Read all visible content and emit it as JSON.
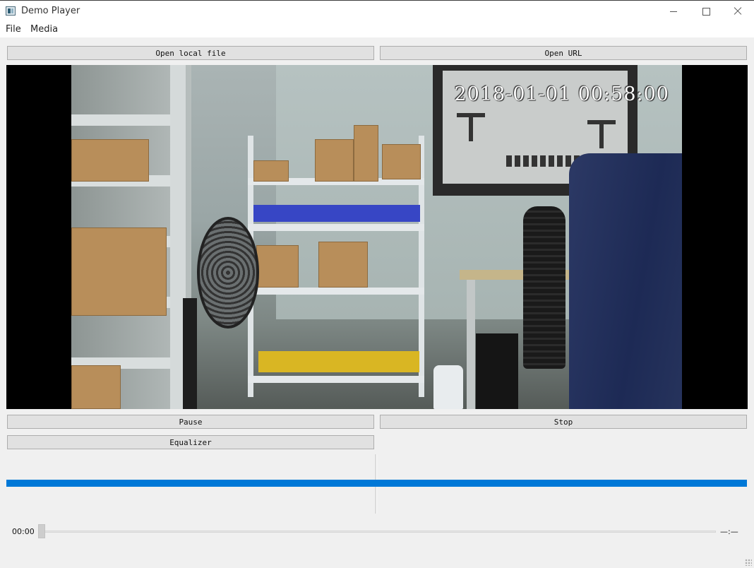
{
  "window": {
    "title": "Demo Player",
    "minimize_icon": "minimize-icon",
    "maximize_icon": "maximize-icon",
    "close_icon": "close-icon"
  },
  "menubar": {
    "items": [
      {
        "label": "File"
      },
      {
        "label": "Media"
      }
    ]
  },
  "toolbar": {
    "open_local_label": "Open local file",
    "open_url_label": "Open URL"
  },
  "video": {
    "overlay_timestamp": "2018-01-01  00:58:00"
  },
  "controls": {
    "pause_label": "Pause",
    "stop_label": "Stop",
    "equalizer_label": "Equalizer"
  },
  "playback": {
    "current_time": "00:00",
    "total_time": "—:—",
    "seek_progress": 0.0,
    "level_progress": 1.0
  },
  "colors": {
    "accent": "#0078d7",
    "window_bg": "#f0f0f0",
    "video_bg": "#000000"
  }
}
